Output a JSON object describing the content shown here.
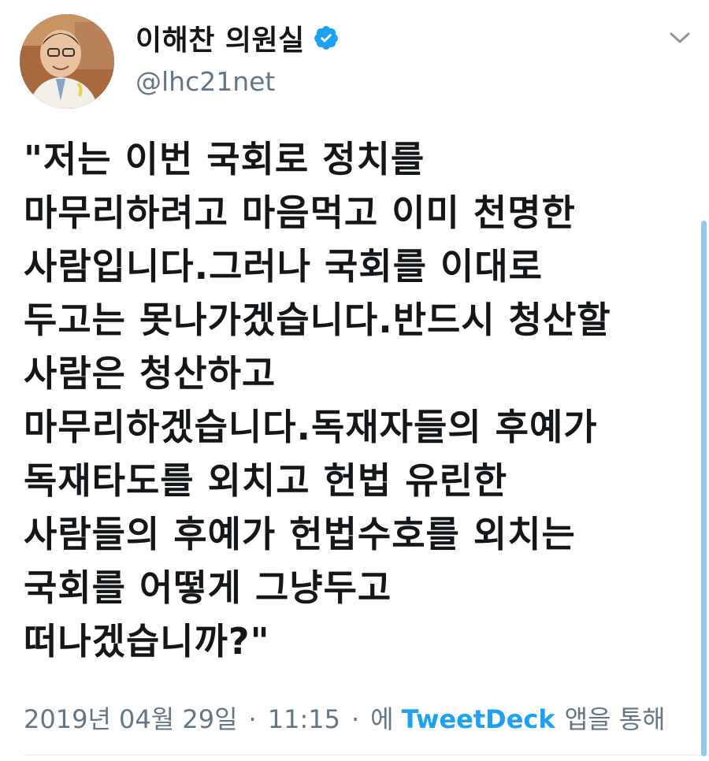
{
  "user": {
    "display_name": "이해찬 의원실",
    "handle": "@lhc21net",
    "verified": true
  },
  "icons": {
    "verified": "verified-badge-icon",
    "menu": "chevron-down-icon"
  },
  "tweet": {
    "lines": [
      "\"저는 이번 국회로 정치를",
      "마무리하려고 마음먹고 이미 천명한",
      "사람입니다.그러나 국회를 이대로",
      "두고는 못나가겠습니다.반드시 청산할",
      "사람은 청산하고",
      "마무리하겠습니다.독재자들의 후예가",
      "독재타도를 외치고 헌법 유린한",
      "사람들의 후예가 헌법수호를 외치는",
      "국회를 어떻게 그냥두고",
      "떠나겠습니까?\""
    ]
  },
  "meta": {
    "date": "2019년 04월 29일",
    "separator": "·",
    "time": "11:15",
    "via_prefix": "에",
    "source": "TweetDeck",
    "via_suffix": "앱을 통해"
  },
  "colors": {
    "link": "#1da1f2",
    "muted": "#657786",
    "text": "#14171a"
  }
}
